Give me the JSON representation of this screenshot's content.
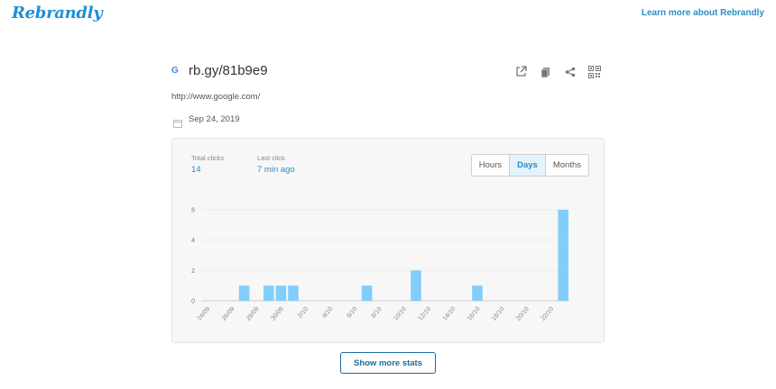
{
  "header": {
    "logo_text": "Rebrandly",
    "learn_more": "Learn more about Rebrandly"
  },
  "link": {
    "short_url": "rb.gy/81b9e9",
    "destination": "http://www.google.com/",
    "created": "Sep 24, 2019",
    "favicon_icon": "google-favicon-icon",
    "actions": [
      "open-external-icon",
      "copy-icon",
      "share-icon",
      "qr-code-icon"
    ]
  },
  "stats": {
    "total_label": "Total clicks",
    "total_value": "14",
    "last_label": "Last click",
    "last_value": "7 min ago",
    "range_options": [
      "Hours",
      "Days",
      "Months"
    ],
    "selected_range": "Days"
  },
  "chart_data": {
    "type": "bar",
    "categories": [
      "24/09",
      "25/09",
      "26/09",
      "27/09",
      "28/09",
      "29/09",
      "30/09",
      "1/10",
      "2/10",
      "3/10",
      "4/10",
      "5/10",
      "6/10",
      "7/10",
      "8/10",
      "9/10",
      "10/10",
      "11/10",
      "12/10",
      "13/10",
      "14/10",
      "15/10",
      "16/10",
      "17/10",
      "18/10",
      "19/10",
      "20/10",
      "21/10",
      "22/10",
      "23/10"
    ],
    "tick_labels": [
      "24/09",
      "26/09",
      "28/09",
      "30/09",
      "2/10",
      "4/10",
      "6/10",
      "8/10",
      "10/10",
      "12/10",
      "14/10",
      "16/10",
      "18/10",
      "20/10",
      "22/10"
    ],
    "values": [
      0,
      0,
      0,
      1,
      0,
      1,
      1,
      1,
      0,
      0,
      0,
      0,
      0,
      1,
      0,
      0,
      0,
      2,
      0,
      0,
      0,
      0,
      1,
      0,
      0,
      0,
      0,
      0,
      0,
      6
    ],
    "y_ticks": [
      0,
      2,
      4,
      6
    ],
    "ylim": [
      0,
      6
    ],
    "bar_color": "#81cdfb",
    "grid": true
  },
  "footer": {
    "more_stats": "Show more stats"
  }
}
